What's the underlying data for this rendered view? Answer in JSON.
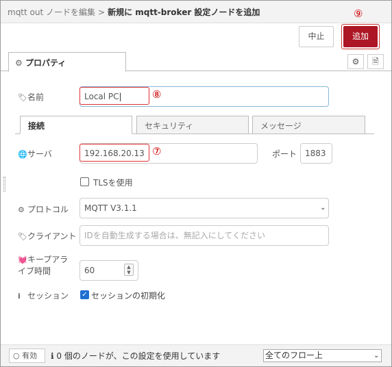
{
  "header": {
    "parent": "mqtt out ノードを編集",
    "separator": ">",
    "current": "新規に mqtt-broker 設定ノードを追加"
  },
  "buttons": {
    "cancel": "中止",
    "add": "追加"
  },
  "markers": {
    "add_button": "⑨",
    "name_field": "⑧",
    "server_field": "⑦"
  },
  "tabs": {
    "properties": "プロパティ"
  },
  "tab_icons": {
    "settings": "gear-icon",
    "description": "file-icon"
  },
  "fields": {
    "name": {
      "label": "名前",
      "value": "Local PC"
    },
    "server": {
      "label": "サーバ",
      "value": "192.168.20.13"
    },
    "port": {
      "label": "ポート",
      "value": "1883"
    },
    "tls": {
      "label": "TLSを使用",
      "checked": false
    },
    "protocol": {
      "label": "プロトコル",
      "value": "MQTT V3.1.1"
    },
    "client": {
      "label": "クライアント",
      "placeholder": "IDを自動生成する場合は、無記入にしてください"
    },
    "keepalive": {
      "label_line1": "キープアラ",
      "label_line2": "イブ時間",
      "value": "60"
    },
    "session": {
      "label": "セッション",
      "checkbox_label": "セッションの初期化",
      "checked": true
    }
  },
  "subtabs": [
    "接続",
    "セキュリティ",
    "メッセージ"
  ],
  "footer": {
    "enable_label": "有効",
    "info_text": "0 個のノードが、この設定を使用しています",
    "scope": "全てのフロー上"
  },
  "colors": {
    "accent": "#ad1625",
    "highlight": "#d33333",
    "focus": "#85b7d9"
  }
}
